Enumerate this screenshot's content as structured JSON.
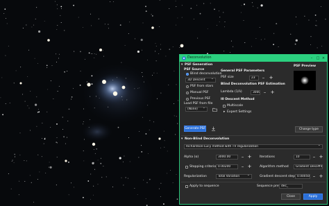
{
  "dialog": {
    "title": "Deconvolution",
    "title_glyphs": {
      "minimize": "–",
      "maximize": "□",
      "close": "×"
    }
  },
  "psf_generation": {
    "header": "PSF Generation",
    "psf_source_label": "PSF Source",
    "blind_deconvolution": "Blind deconvolution",
    "algorithm_value": "3D Descent",
    "psf_from_stars": "PSF from stars",
    "manual_psf": "Manual PSF",
    "previous_psf": "Previous PSF",
    "load_psf_label": "Load PSF from file",
    "file_value": "(None)",
    "generate_psf_button": "Generate PSF",
    "general_params_header": "General PSF Parameters",
    "psf_size_label": "PSF size",
    "psf_size_value": "23",
    "blind_estimation_header": "Blind Deconvolution PSF Estimation",
    "lambda_label": "Lambda (1/λ)",
    "lambda_value": "3000",
    "descent_method_header": "l0 Descent Method",
    "multiscale_label": "Multiscale",
    "expert_settings_label": "Expert Settings",
    "preview_label": "PSF Preview",
    "change_type_button": "Change type"
  },
  "non_blind": {
    "header": "Non-Blind Deconvolution",
    "method_value": "Richardson-Lucy method with TV regularization",
    "alpha_label": "Alpha (α)",
    "alpha_value": "3000.00",
    "iterations_label": "Iterations",
    "iterations_value": "10",
    "stopping_label": "Stopping criterion",
    "stopping_value": "0.00200",
    "algorithm_method_label": "Algorithm method",
    "algorithm_method_value": "Gradient Descent",
    "regularization_label": "Regularization",
    "regularization_value": "Total Variation",
    "step_size_label": "Gradient descent step size",
    "step_size_value": "0.00050"
  },
  "footer": {
    "apply_to_sequence": "Apply to sequence",
    "sequence_prefix_label": "Sequence prefix:",
    "sequence_prefix_value": "dec_",
    "close_button": "Close",
    "apply_button": "Apply"
  }
}
